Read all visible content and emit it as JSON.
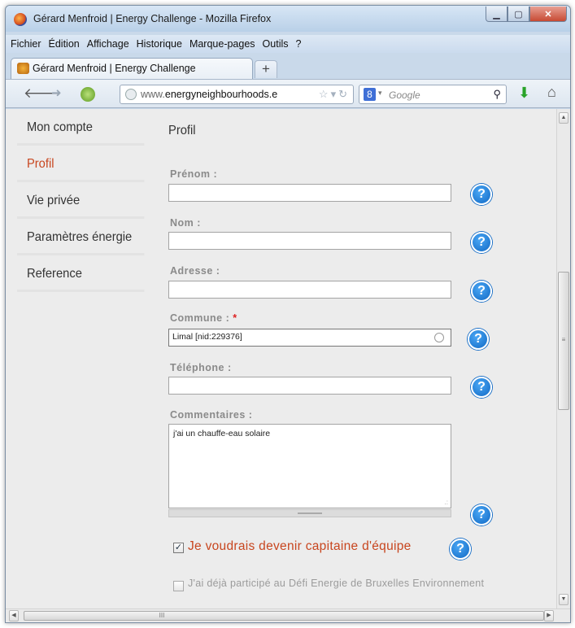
{
  "window": {
    "title": "Gérard Menfroid | Energy Challenge - Mozilla Firefox",
    "app_icon": "firefox-icon"
  },
  "menu": [
    "Fichier",
    "Édition",
    "Affichage",
    "Historique",
    "Marque-pages",
    "Outils",
    "?"
  ],
  "tab": {
    "label": "Gérard Menfroid | Energy Challenge",
    "new_tab_label": "+"
  },
  "navbar": {
    "url_prefix": "www.",
    "url_domain": "energyneighbourhoods.e",
    "search_placeholder": "Google"
  },
  "sidebar": {
    "items": [
      {
        "label": "Mon compte",
        "active": false
      },
      {
        "label": "Profil",
        "active": true
      },
      {
        "label": "Vie privée",
        "active": false
      },
      {
        "label": "Paramètres énergie",
        "active": false
      },
      {
        "label": "Reference",
        "active": false
      }
    ]
  },
  "form": {
    "title": "Profil",
    "prenom": {
      "label": "Prénom :",
      "value": ""
    },
    "nom": {
      "label": "Nom :",
      "value": ""
    },
    "adresse": {
      "label": "Adresse :",
      "value": ""
    },
    "commune": {
      "label": "Commune :",
      "required_mark": "*",
      "value": "Limal [nid:229376]"
    },
    "telephone": {
      "label": "Téléphone :",
      "value": ""
    },
    "commentaires": {
      "label": "Commentaires :",
      "value": "j'ai un chauffe-eau solaire"
    },
    "captain": {
      "label": "Je voudrais devenir capitaine d'équipe",
      "checked": true
    },
    "defi": {
      "label": "J'ai déjà participé au Défi Energie de Bruxelles Environnement",
      "checked": false
    },
    "help_glyph": "?"
  },
  "colors": {
    "accent": "#c8461f",
    "help": "#1169c4",
    "required": "#dd2222"
  }
}
